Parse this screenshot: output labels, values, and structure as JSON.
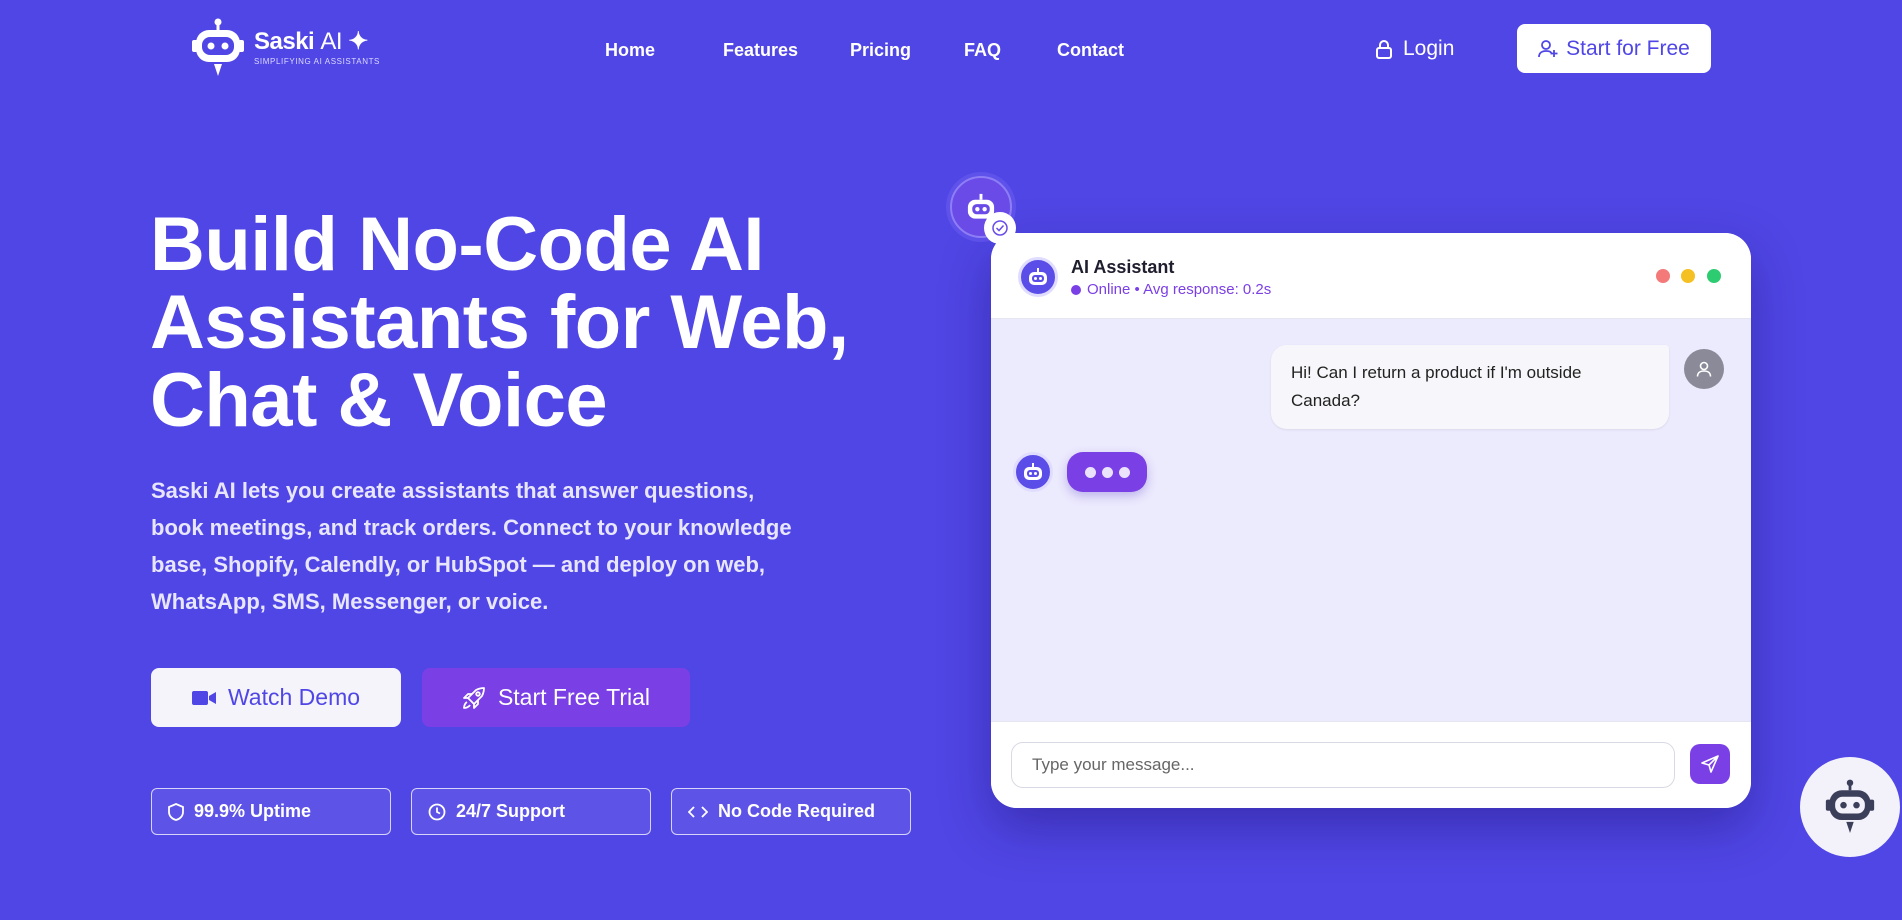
{
  "brand": {
    "name": "Saski",
    "name_suffix": "AI",
    "tagline": "SIMPLIFYING AI ASSISTANTS"
  },
  "nav": {
    "links": [
      "Home",
      "Features",
      "Pricing",
      "FAQ",
      "Contact"
    ],
    "login_label": "Login",
    "cta_label": "Start for Free"
  },
  "hero": {
    "headline_lines": [
      "Build No-Code AI",
      "Assistants for Web,",
      "Chat & Voice"
    ],
    "subtext": "Saski AI lets you create assistants that answer questions, book meetings, and track orders. Connect to your knowledge base, Shopify, Calendly, or HubSpot — and deploy on web, WhatsApp, SMS, Messenger, or voice.",
    "demo_label": "Watch Demo",
    "trial_label": "Start Free Trial",
    "badges": [
      "99.9% Uptime",
      "24/7 Support",
      "No Code Required"
    ]
  },
  "chat": {
    "title": "AI Assistant",
    "status": "Online • Avg response: 0.2s",
    "user_message": "Hi! Can I return a product if I'm outside Canada?",
    "input_placeholder": "Type your message..."
  },
  "colors": {
    "background": "#5046e5",
    "accent": "#7b3fe6",
    "chat_body": "#eceafd"
  },
  "icons": [
    "robot-icon",
    "sparkle-icon",
    "lock-icon",
    "user-plus-icon",
    "video-icon",
    "rocket-icon",
    "shield-icon",
    "clock-icon",
    "code-icon",
    "check-circle-icon",
    "user-icon",
    "send-icon"
  ]
}
